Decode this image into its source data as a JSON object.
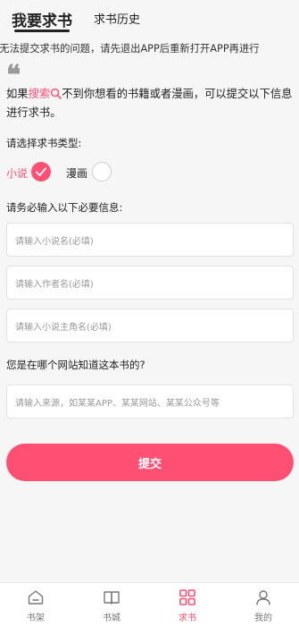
{
  "header": {
    "tabs": [
      {
        "label": "我要求书",
        "active": true
      },
      {
        "label": "求书历史",
        "active": false
      }
    ]
  },
  "notice": "现无法提交求书的问题，请先退出APP后重新打开APP再进行",
  "intro": {
    "prefix": "如果",
    "link": "搜索",
    "rest_line1": "不到你想看的书籍或者漫画，可以提交以下信息",
    "rest_line2": "进行求书。"
  },
  "type_section": {
    "label": "请选择求书类型:",
    "options": [
      {
        "label": "小说",
        "selected": true
      },
      {
        "label": "漫画",
        "selected": false
      }
    ]
  },
  "required_label": "请务必输入以下必要信息:",
  "fields": {
    "novel_name_placeholder": "请输入小说名(必填)",
    "author_placeholder": "请输入作者名(必填)",
    "protagonist_placeholder": "请输入小说主角名(必填)"
  },
  "source_section": {
    "label": "您是在哪个网站知道这本书的?",
    "placeholder": "请输入来源，如某某APP、某某网站、某某公众号等"
  },
  "submit_label": "提交",
  "bottom_nav": [
    {
      "label": "书架",
      "icon": "bookshelf-icon",
      "active": false
    },
    {
      "label": "书城",
      "icon": "book-icon",
      "active": false
    },
    {
      "label": "求书",
      "icon": "grid-icon",
      "active": true
    },
    {
      "label": "我的",
      "icon": "user-icon",
      "active": false
    }
  ],
  "colors": {
    "accent": "#ff4f73",
    "background": "#f6f6f6"
  }
}
